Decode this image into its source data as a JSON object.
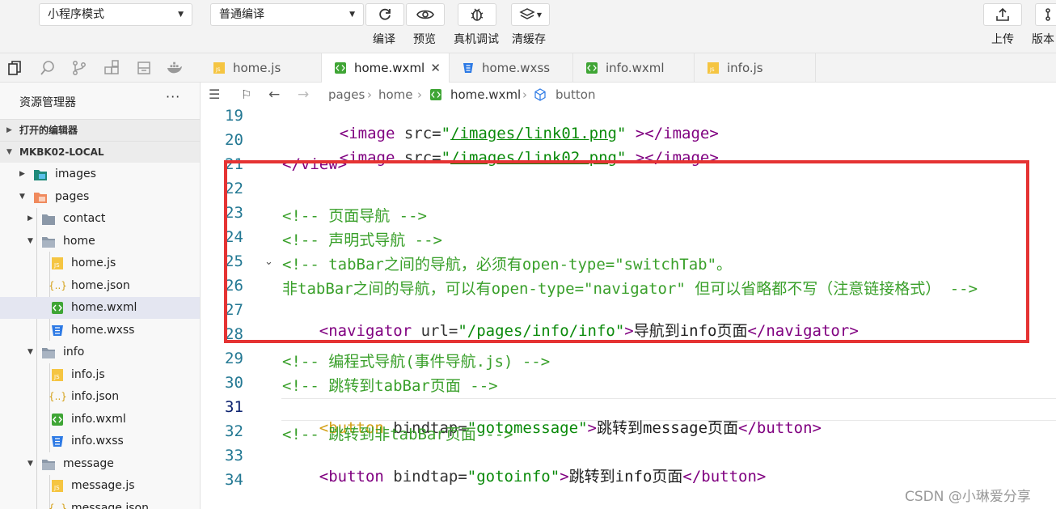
{
  "toolbar": {
    "mode_select": "小程序模式",
    "compile_select": "普通编译",
    "compile_label": "编译",
    "preview_label": "预览",
    "debug_label": "真机调试",
    "clear_cache_label": "清缓存",
    "upload_label": "上传",
    "version_label": "版本"
  },
  "sidebar": {
    "title": "资源管理器",
    "more": "···",
    "open_editors": "打开的编辑器",
    "project": "MKBK02-LOCAL",
    "items": [
      {
        "label": "images"
      },
      {
        "label": "pages"
      },
      {
        "label": "contact"
      },
      {
        "label": "home"
      },
      {
        "label": "home.js"
      },
      {
        "label": "home.json"
      },
      {
        "label": "home.wxml"
      },
      {
        "label": "home.wxss"
      },
      {
        "label": "info"
      },
      {
        "label": "info.js"
      },
      {
        "label": "info.json"
      },
      {
        "label": "info.wxml"
      },
      {
        "label": "info.wxss"
      },
      {
        "label": "message"
      },
      {
        "label": "message.js"
      },
      {
        "label": "message.json"
      }
    ]
  },
  "tabs": [
    {
      "label": "home.js"
    },
    {
      "label": "home.wxml",
      "close": "✕"
    },
    {
      "label": "home.wxss"
    },
    {
      "label": "info.wxml"
    },
    {
      "label": "info.js"
    }
  ],
  "breadcrumb": {
    "p1": "pages",
    "p2": "home",
    "p3": "home.wxml",
    "p4": "button"
  },
  "editor": {
    "lines": [
      {
        "n": "19"
      },
      {
        "n": "20"
      },
      {
        "n": "21"
      },
      {
        "n": "22"
      },
      {
        "n": "23"
      },
      {
        "n": "24"
      },
      {
        "n": "25"
      },
      {
        "n": "26"
      },
      {
        "n": "27"
      },
      {
        "n": "28"
      },
      {
        "n": "29"
      },
      {
        "n": "30"
      },
      {
        "n": "31"
      },
      {
        "n": "32"
      },
      {
        "n": "33"
      },
      {
        "n": "34"
      }
    ],
    "c19_tag": "<image",
    "c19_attr": " src=",
    "c19_q1": "\"",
    "c19_val": "/images/link01.png",
    "c19_q2": "\"",
    "c19_end": " ></image>",
    "c20_tag": "<image",
    "c20_attr": " src=",
    "c20_q1": "\"",
    "c20_val": "/images/link02.png",
    "c20_q2": "\"",
    "c20_end": " ></image>",
    "c21": "</view>",
    "c23": "<!-- 页面导航 -->",
    "c24": "<!-- 声明式导航 -->",
    "c25": "<!-- tabBar之间的导航，必须有open-type=\"switchTab\"。",
    "c26": "非tabBar之间的导航，可以有open-type=\"navigator\" 但可以省略都不写（注意链接格式） -->",
    "c27_open": "<navigator",
    "c27_attr": " url=",
    "c27_val": "\"/pages/info/info\"",
    "c27_gt": ">",
    "c27_text": "导航到info页面",
    "c27_close": "</navigator>",
    "c29": "<!-- 编程式导航(事件导航.js) -->",
    "c30": "<!-- 跳转到tabBar页面 -->",
    "c31_open": "<button",
    "c31_attr": " bindtap=",
    "c31_val": "\"gotomessage\"",
    "c31_gt": ">",
    "c31_text": "跳转到message页面",
    "c31_close": "</button>",
    "c32": "<!-- 跳转到非tabBar页面 -->",
    "c33_open": "<button",
    "c33_attr": " bindtap=",
    "c33_val": "\"gotoinfo\"",
    "c33_gt": ">",
    "c33_text": "跳转到info页面",
    "c33_close": "</button>"
  },
  "watermark": "CSDN @小琳爱分享",
  "colors": {
    "highlight_box": "#e53333",
    "selected_row": "#e4e6f1",
    "comment": "#3aa02b",
    "tag": "#800080"
  }
}
